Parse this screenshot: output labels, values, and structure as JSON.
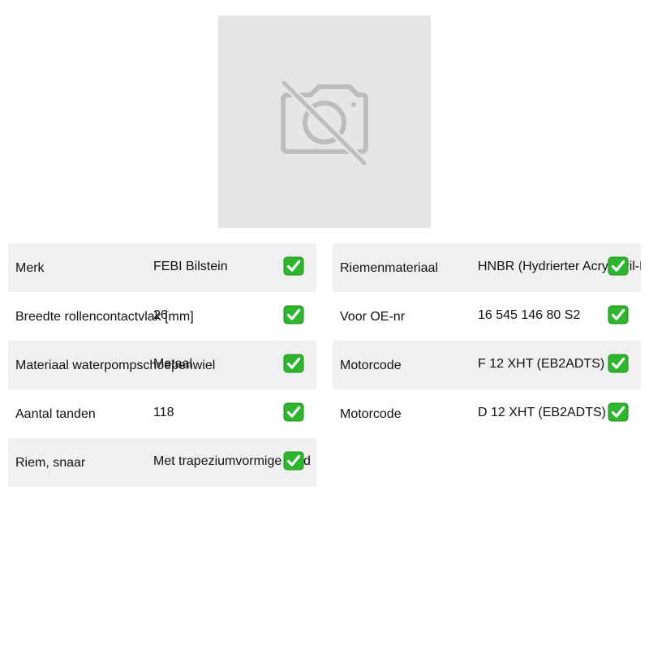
{
  "colors": {
    "placeholder_bg": "#e6e6e6",
    "row_shade": "#f0f0f0",
    "check_green": "#2fb52f"
  },
  "image": {
    "icon": "no-image-icon"
  },
  "specs_left": [
    {
      "label": "Merk",
      "value": "FEBI Bilstein",
      "icon": "check-icon",
      "shaded": true
    },
    {
      "label": "Breedte rollencontactvlak [mm]",
      "value": "26",
      "icon": "check-icon",
      "shaded": false
    },
    {
      "label": "Materiaal waterpompschoepenwiel",
      "value": "Metaal",
      "icon": "check-icon",
      "shaded": true
    },
    {
      "label": "Aantal tanden",
      "value": "118",
      "icon": "check-icon",
      "shaded": false
    },
    {
      "label": "Riem, snaar",
      "value": "Met trapeziumvormige tand",
      "icon": "check-icon",
      "shaded": true
    }
  ],
  "specs_right": [
    {
      "label": "Riemenmateriaal",
      "value": "HNBR (Hydrierter Acrylnitril-Butadien-Kautschuk)",
      "icon": "check-icon",
      "shaded": true
    },
    {
      "label": "Voor OE-nr",
      "value": "16 545 146 80 S2",
      "icon": "check-icon",
      "shaded": false
    },
    {
      "label": "Motorcode",
      "value": "F 12 XHT (EB2ADTS)",
      "icon": "check-icon",
      "shaded": true
    },
    {
      "label": "Motorcode",
      "value": "D 12 XHT (EB2ADTS)",
      "icon": "check-icon",
      "shaded": false
    }
  ]
}
